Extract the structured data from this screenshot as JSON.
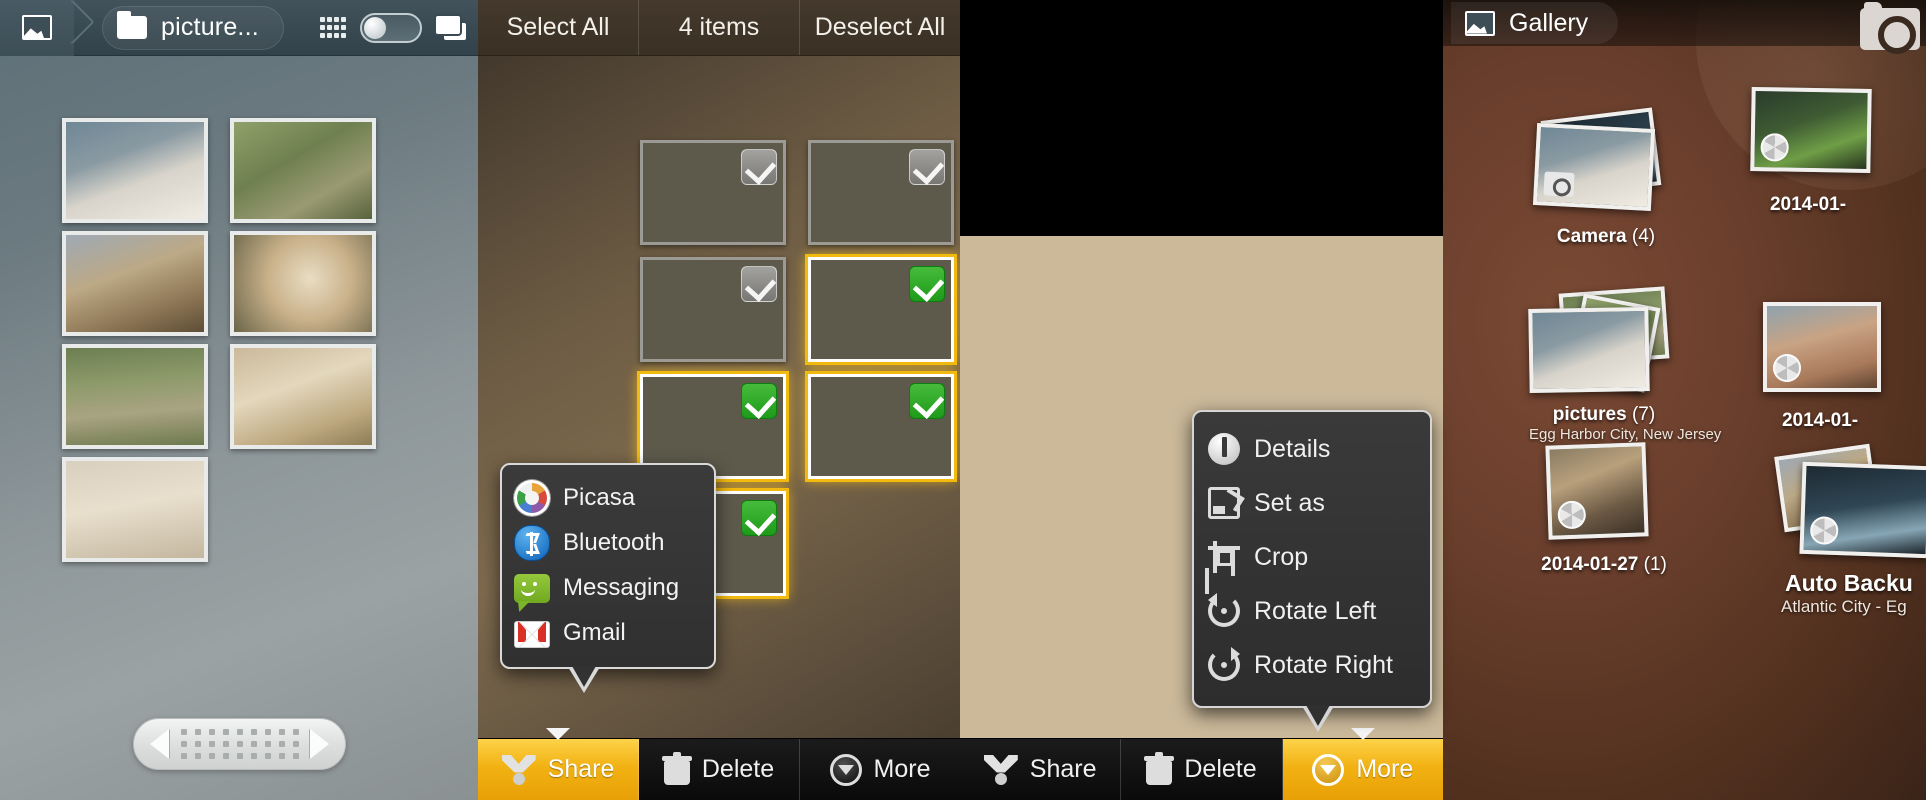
{
  "panel1": {
    "home_icon": "photo-icon",
    "breadcrumb": {
      "folder_icon": "folder-icon",
      "label": "picture..."
    },
    "right_icons": [
      "grid-view-icon",
      "view-toggle-switch",
      "stack-view-icon"
    ],
    "thumbnails": [
      {
        "name": "dog-with-teddy-bear"
      },
      {
        "name": "shepherd-on-grass"
      },
      {
        "name": "two-dogs-playing"
      },
      {
        "name": "poodle-closeup"
      },
      {
        "name": "dog-in-yard"
      },
      {
        "name": "poodle-lying-on-rug"
      },
      {
        "name": "poodle-being-fed"
      }
    ],
    "pager": {
      "prev_icon": "triangle-left-icon",
      "next_icon": "triangle-right-icon",
      "dots": 27
    }
  },
  "panel2": {
    "actionbar": {
      "select_all": "Select All",
      "count": "4 items",
      "deselect_all": "Deselect All"
    },
    "thumbnails": [
      {
        "name": "dog-with-teddy-bear",
        "selected": false
      },
      {
        "name": "shepherd-on-grass",
        "selected": false
      },
      {
        "name": "two-dogs-playing",
        "selected": false
      },
      {
        "name": "poodle-closeup",
        "selected": true
      },
      {
        "name": "dog-in-yard",
        "selected": true
      },
      {
        "name": "poodle-lying-on-rug",
        "selected": true
      },
      {
        "name": "poodle-being-fed",
        "selected": true
      }
    ],
    "share_popup": {
      "items": [
        {
          "icon": "picasa-icon",
          "label": "Picasa"
        },
        {
          "icon": "bluetooth-icon",
          "label": "Bluetooth"
        },
        {
          "icon": "messaging-icon",
          "label": "Messaging"
        },
        {
          "icon": "gmail-icon",
          "label": "Gmail"
        }
      ]
    },
    "bottombar": [
      {
        "icon": "share-icon",
        "label": "Share",
        "active": true
      },
      {
        "icon": "trash-icon",
        "label": "Delete",
        "active": false
      },
      {
        "icon": "more-icon",
        "label": "More",
        "active": false
      }
    ]
  },
  "panel3": {
    "photo": {
      "name": "poodle-being-fed-large"
    },
    "more_popup": {
      "items": [
        {
          "icon": "info-icon",
          "label": "Details"
        },
        {
          "icon": "set-as-icon",
          "label": "Set as"
        },
        {
          "icon": "crop-icon",
          "label": "Crop"
        },
        {
          "icon": "rotate-left-icon",
          "label": "Rotate Left"
        },
        {
          "icon": "rotate-right-icon",
          "label": "Rotate Right"
        }
      ]
    },
    "bottombar": [
      {
        "icon": "share-icon",
        "label": "Share",
        "active": false
      },
      {
        "icon": "trash-icon",
        "label": "Delete",
        "active": false
      },
      {
        "icon": "more-icon",
        "label": "More",
        "active": true
      }
    ]
  },
  "panel4": {
    "actionbar": {
      "gallery_icon": "photo-icon",
      "label": "Gallery",
      "camera_icon": "camera-icon"
    },
    "albums": [
      {
        "name": "Camera",
        "count": "(4)",
        "subtitle": "",
        "badge": "camera-badge-icon"
      },
      {
        "name": "2014-01-",
        "count": "",
        "subtitle": "",
        "badge": "picasa-badge-icon"
      },
      {
        "name": "pictures",
        "count": "(7)",
        "subtitle": "Egg Harbor City, New Jersey",
        "badge": ""
      },
      {
        "name": "2014-01-",
        "count": "",
        "subtitle": "",
        "badge": "picasa-badge-icon"
      },
      {
        "name": "2014-01-27",
        "count": "(1)",
        "subtitle": "",
        "badge": "picasa-badge-icon"
      },
      {
        "name": "Auto Backu",
        "count": "",
        "subtitle": "Atlantic City - Eg",
        "badge": "picasa-badge-icon"
      }
    ]
  },
  "colors": {
    "accent": "#f2b213",
    "selected_check": "#2ba022",
    "popup_bg": "#333333"
  }
}
